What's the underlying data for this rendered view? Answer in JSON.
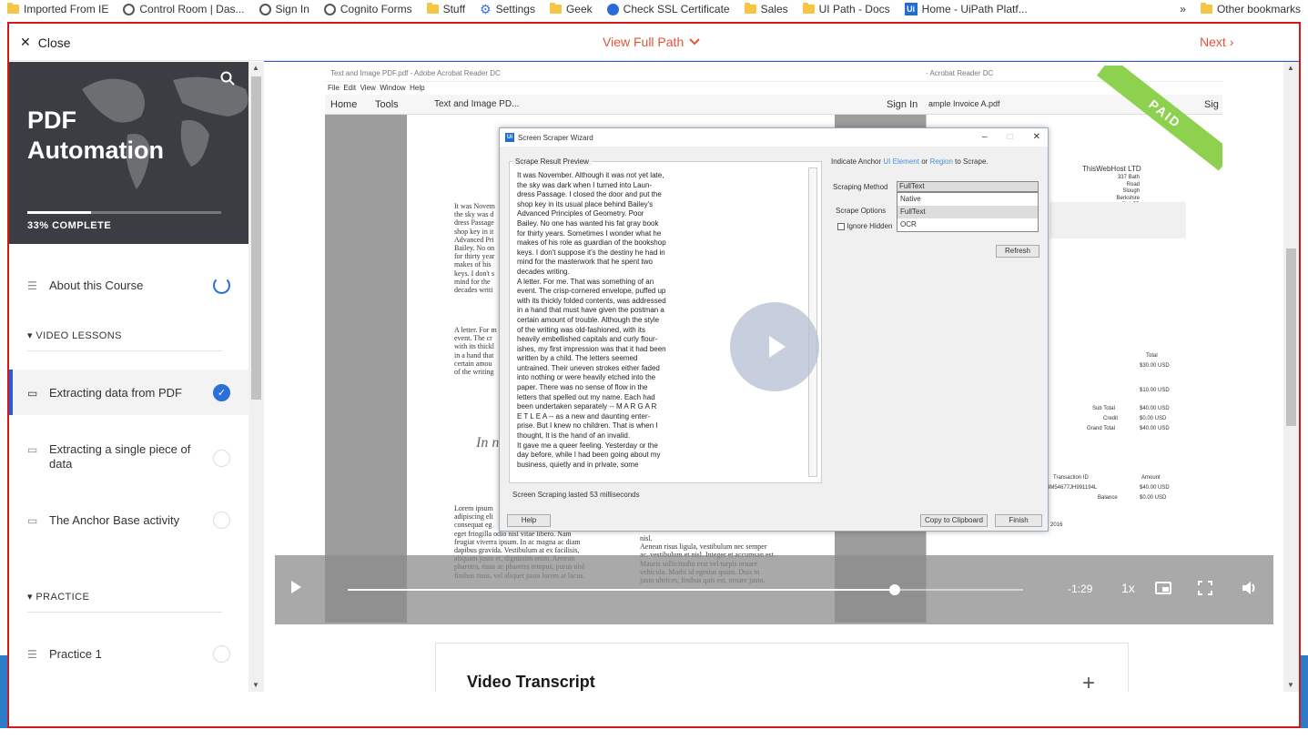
{
  "bookmarks": {
    "items": [
      {
        "label": "Imported From IE",
        "icon": "folder-icon"
      },
      {
        "label": "Control Room | Das...",
        "icon": "globe-icon"
      },
      {
        "label": "Sign In",
        "icon": "globe-icon"
      },
      {
        "label": "Cognito Forms",
        "icon": "globe-icon"
      },
      {
        "label": "Stuff",
        "icon": "folder-icon"
      },
      {
        "label": "Settings",
        "icon": "gear-icon"
      },
      {
        "label": "Geek",
        "icon": "folder-icon"
      },
      {
        "label": "Check SSL Certificate",
        "icon": "ssl-icon"
      },
      {
        "label": "Sales",
        "icon": "folder-icon"
      },
      {
        "label": "UI Path - Docs",
        "icon": "folder-icon"
      },
      {
        "label": "Home - UiPath Platf...",
        "icon": "uipath-icon"
      }
    ],
    "more": "»",
    "other": "Other bookmarks"
  },
  "topbar": {
    "close_label": "Close",
    "view_path_label": "View Full Path",
    "next_label": "Next"
  },
  "course": {
    "title": "PDF Automation",
    "progress_label": "33% COMPLETE",
    "progress_fraction": 0.33
  },
  "sidebar": {
    "about": "About this Course",
    "video_section": "VIDEO LESSONS",
    "lessons": [
      {
        "label": "Extracting data from PDF",
        "status": "complete"
      },
      {
        "label": "Extracting a single piece of data",
        "status": "incomplete"
      },
      {
        "label": "The Anchor Base activity",
        "status": "incomplete"
      }
    ],
    "practice_section": "PRACTICE",
    "practice": [
      {
        "label": "Practice 1",
        "status": "incomplete"
      }
    ]
  },
  "video": {
    "window_title": "Text and Image PDF.pdf - Adobe Acrobat Reader DC",
    "window_title_right": "- Acrobat Reader DC",
    "menu": [
      "File",
      "Edit",
      "View",
      "Window",
      "Help"
    ],
    "tabs": {
      "home": "Home",
      "tools": "Tools",
      "doc_tab": "Text and Image PD...",
      "sign_in": "Sign In",
      "doc_tab_right": "ample Invoice A.pdf",
      "sign_right": "Sig"
    },
    "doc_left_text": "It was Novem\nthe sky was d\ndress Passage\nshop key in it\nAdvanced Pri\nBailey. No on\nfor thirty year\nmakes of his\nkeys. I don't s\nmind for the\ndecades writi",
    "doc_left_text2": "A letter. For m\nevent. The cr\nwith its thickl\nin a hand that\ncertain amou\nof the writing",
    "doc_italic": "In n",
    "doc_bottom_left": "Lorem ipsum\nadipiscing eli\nconsequat eg\neget fringilla odio nisl vitae libero. Nam\nfeugiat viverra ipsum. In ac magna ac diam\ndapibus gravida. Vestibulum at ex facilisis,\naliquam justo et, dignissim enim. Aenean\npharetra, risus ac pharetra tempus, purus nisl\nfinibus risus, vel aliquet justo lorem at lacus.",
    "doc_bottom_right": "nisl.\nAenean risus ligula, vestibulum nec semper\nac, vestibulum et nisl. Integer et accumsan est.\nMauris sollicitudin erat vel turpis ornare\nvehicula. Morbi id egestas quam. Duis in\njusto ultrices, finibus quis est, ornare justo.",
    "invoice": {
      "paid": "PAID",
      "company": "ThisWebHost LTD",
      "address": "337 Bath Road\nSlough\nBerkshire\nSL1 5P\nUnited Kingdom",
      "total_header": "Total",
      "line1": "$30.00 USD",
      "line2": "$10.00 USD",
      "sub_total_label": "Sub Total",
      "sub_total": "$40.00 USD",
      "credit_label": "Credit",
      "credit": "$0.00 USD",
      "grand_total_label": "Grand Total",
      "grand_total": "$40.00 USD",
      "txn_header": "Transaction ID",
      "amount_header": "Amount",
      "txn_id": "4M54677JH991194L",
      "txn_amount": "$40.00 USD",
      "balance_label": "Balance",
      "balance": "$0.00 USD",
      "year": "2016"
    },
    "wizard": {
      "title": "Screen Scraper Wizard",
      "preview_label": "Scrape Result Preview",
      "preview_text": "It was November. Although it was not yet late,\nthe sky was dark when I turned into Laun-\ndress Passage. I closed the door and put the\nshop key in its usual place behind Bailey's\nAdvanced Principles of Geometry. Poor\nBailey. No one has wanted his fat gray book\nfor thirty years. Sometimes I wonder what he\nmakes of his role as guardian of the bookshop\nkeys. I don't suppose it's the destiny he had in\nmind for the masterwork that he spent two\ndecades writing.\nA letter. For me. That was something of an\nevent. The crisp-cornered envelope, puffed up\nwith its thickly folded contents, was addressed\nin a hand that must have given the postman a\ncertain amount of trouble. Although the style\nof the writing was old-fashioned, with its\nheavily embellished capitals and curly flour-\nishes, my first impression was that it had been\nwritten by a child. The letters seemed\nuntrained. Their uneven strokes either faded\ninto nothing or were heavily etched into the\npaper. There was no sense of flow in the\nletters that spelled out my name. Each had\nbeen undertaken separately -- M A R G A R\nE T L E A -- as a new and daunting enter-\nprise. But I knew no children. That is when I\nthought, It is the hand of an invalid.\nIt gave me a queer feeling. Yesterday or the\nday before, while I had been going about my\nbusiness, quietly and in private, some",
      "indicate_anchor": "Indicate Anchor",
      "ui_element": "UI Element",
      "or": "or",
      "region": "Region",
      "to_scrape": "to Scrape.",
      "scraping_method_label": "Scraping Method",
      "scraping_method_value": "FullText",
      "options": [
        "Native",
        "FullText",
        "OCR"
      ],
      "scrape_options_label": "Scrape Options",
      "ignore_hidden": "Ignore Hidden",
      "refresh": "Refresh",
      "status": "Screen Scraping lasted 53 milliseconds",
      "help": "Help",
      "copy": "Copy to Clipboard",
      "finish": "Finish"
    },
    "controls": {
      "time_remaining": "-1:29",
      "speed": "1x",
      "progress_fraction": 0.81
    }
  },
  "transcript": {
    "title": "Video Transcript",
    "expand": "+"
  }
}
